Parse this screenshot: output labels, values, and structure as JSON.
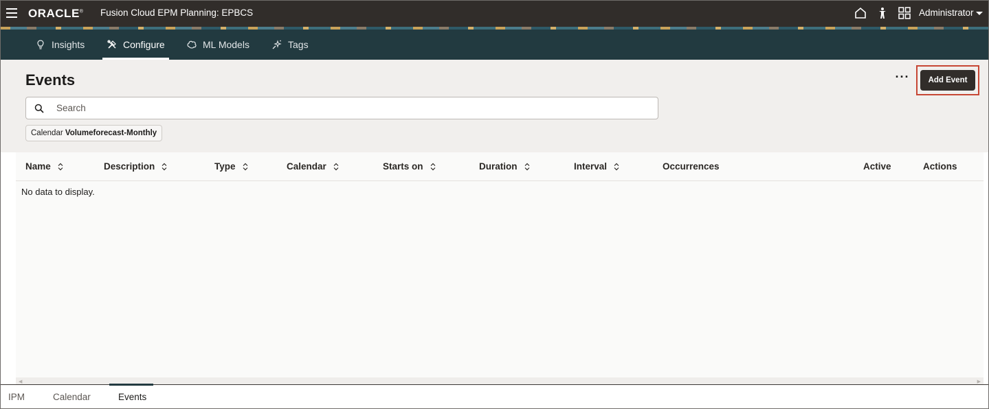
{
  "header": {
    "logo": "ORACLE",
    "logo_mark": "®",
    "app_title": "Fusion Cloud EPM Planning:  EPBCS",
    "user": "Administrator"
  },
  "tabs": [
    {
      "label": "Insights",
      "icon": "lightbulb-icon"
    },
    {
      "label": "Configure",
      "icon": "tools-icon",
      "active": true
    },
    {
      "label": "ML Models",
      "icon": "brain-icon"
    },
    {
      "label": "Tags",
      "icon": "sparkle-tag-icon"
    }
  ],
  "page": {
    "title": "Events",
    "more_label": "···",
    "add_button": "Add Event"
  },
  "search": {
    "placeholder": "Search",
    "value": ""
  },
  "filter": {
    "label": "Calendar",
    "value": "Volumeforecast-Monthly"
  },
  "table": {
    "columns": [
      "Name",
      "Description",
      "Type",
      "Calendar",
      "Starts on",
      "Duration",
      "Interval",
      "Occurrences",
      "Active",
      "Actions"
    ],
    "empty_message": "No data to display."
  },
  "bottom_nav": [
    {
      "label": "IPM"
    },
    {
      "label": "Calendar"
    },
    {
      "label": "Events",
      "active": true
    }
  ],
  "colors": {
    "header_bg": "#312d2a",
    "tabbar_bg": "#223a40",
    "highlight": "#c74634",
    "button_bg": "#312d2a"
  }
}
